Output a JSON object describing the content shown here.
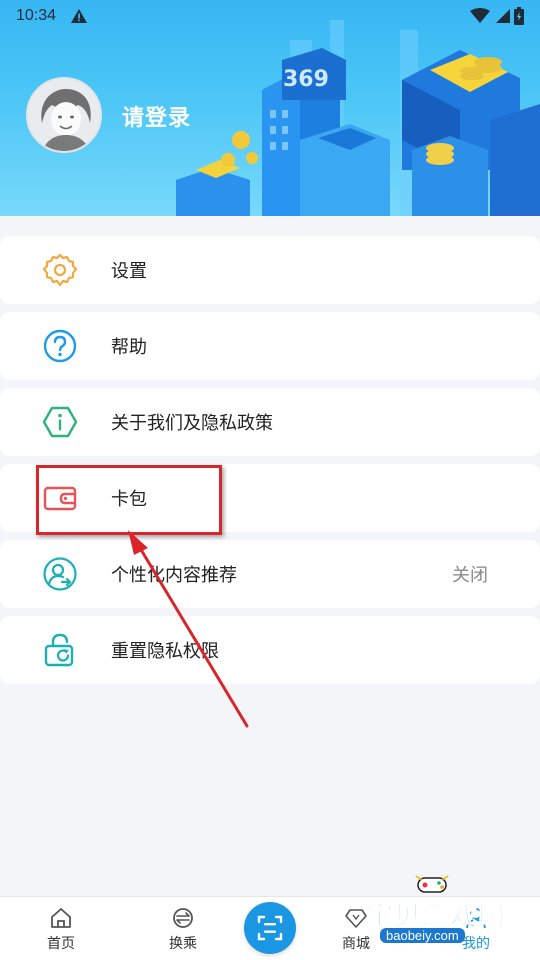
{
  "status_bar": {
    "time": "10:34"
  },
  "header": {
    "login_prompt": "请登录",
    "building_number": "369"
  },
  "menu": {
    "items": [
      {
        "label": "设置",
        "icon": "gear-icon"
      },
      {
        "label": "帮助",
        "icon": "question-icon"
      },
      {
        "label": "关于我们及隐私政策",
        "icon": "info-icon"
      },
      {
        "label": "卡包",
        "icon": "wallet-icon"
      },
      {
        "label": "个性化内容推荐",
        "icon": "user-recommend-icon",
        "value": "关闭"
      },
      {
        "label": "重置隐私权限",
        "icon": "unlock-icon"
      }
    ]
  },
  "bottom_nav": {
    "items": [
      {
        "label": "首页",
        "icon": "home-icon"
      },
      {
        "label": "换乘",
        "icon": "transfer-icon"
      },
      {
        "label": "",
        "icon": "scan-icon"
      },
      {
        "label": "商城",
        "icon": "shop-icon"
      },
      {
        "label": "我的",
        "icon": "profile-icon"
      }
    ]
  },
  "watermark": {
    "title": "宝贝游戏网",
    "url": "baobeiy.com"
  },
  "colors": {
    "accent": "#1a96e3",
    "annotation": "#d8262b",
    "header_top": "#37b6f3"
  }
}
